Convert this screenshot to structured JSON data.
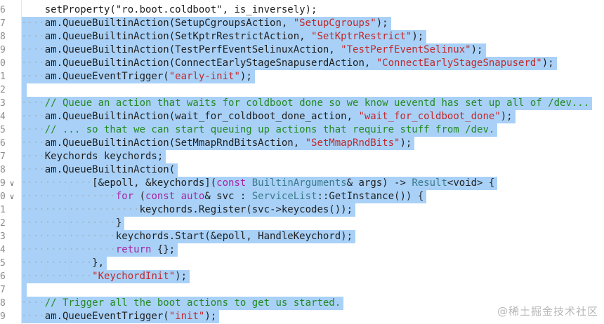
{
  "editor": {
    "line_numbers": [
      "6",
      "7",
      "8",
      "9",
      "0",
      "1",
      "2",
      "3",
      "4",
      "5",
      "6",
      "7",
      "8",
      "9",
      "0",
      "1",
      "2",
      "3",
      "4",
      "5",
      "6",
      "7",
      "8",
      "9"
    ],
    "fold_markers": {
      "13": "chevron-down",
      "14": "chevron-down"
    },
    "top_partial": "setProperty(\"ro.boot.coldboot\", is_inversely);",
    "lines": [
      {
        "indent": 1,
        "tokens": [
          [
            "am.QueueBuiltinAction(SetupCgroupsAction, ",
            "p"
          ],
          [
            "\"SetupCgroups\"",
            "s"
          ],
          [
            ");",
            "p"
          ]
        ]
      },
      {
        "indent": 1,
        "tokens": [
          [
            "am.QueueBuiltinAction(SetKptrRestrictAction, ",
            "p"
          ],
          [
            "\"SetKptrRestrict\"",
            "s"
          ],
          [
            ");",
            "p"
          ]
        ]
      },
      {
        "indent": 1,
        "tokens": [
          [
            "am.QueueBuiltinAction(TestPerfEventSelinuxAction, ",
            "p"
          ],
          [
            "\"TestPerfEventSelinux\"",
            "s"
          ],
          [
            ");",
            "p"
          ]
        ]
      },
      {
        "indent": 1,
        "tokens": [
          [
            "am.QueueBuiltinAction(ConnectEarlyStageSnapuserdAction, ",
            "p"
          ],
          [
            "\"ConnectEarlyStageSnapuserd\"",
            "s"
          ],
          [
            ");",
            "p"
          ]
        ]
      },
      {
        "indent": 1,
        "tokens": [
          [
            "am.QueueEventTrigger(",
            "p"
          ],
          [
            "\"early-init\"",
            "s"
          ],
          [
            ");",
            "p"
          ]
        ]
      },
      {
        "indent": 0,
        "tokens": []
      },
      {
        "indent": 1,
        "tokens": [
          [
            "// Queue an action that waits for coldboot done so we know ueventd has set up all of /dev...",
            "c"
          ]
        ]
      },
      {
        "indent": 1,
        "tokens": [
          [
            "am.QueueBuiltinAction(wait_for_coldboot_done_action, ",
            "p"
          ],
          [
            "\"wait_for_coldboot_done\"",
            "s"
          ],
          [
            ");",
            "p"
          ]
        ]
      },
      {
        "indent": 1,
        "tokens": [
          [
            "// ... so that we can start queuing up actions that require stuff from /dev.",
            "c"
          ]
        ]
      },
      {
        "indent": 1,
        "tokens": [
          [
            "am.QueueBuiltinAction(SetMmapRndBitsAction, ",
            "p"
          ],
          [
            "\"SetMmapRndBits\"",
            "s"
          ],
          [
            ");",
            "p"
          ]
        ]
      },
      {
        "indent": 1,
        "tokens": [
          [
            "Keychords keychords;",
            "p"
          ]
        ]
      },
      {
        "indent": 1,
        "tokens": [
          [
            "am.QueueBuiltinAction(",
            "p"
          ]
        ]
      },
      {
        "indent": 3,
        "tokens": [
          [
            "[&epoll, &keychords](",
            "p"
          ],
          [
            "const ",
            "k"
          ],
          [
            "BuiltinArguments",
            "ty"
          ],
          [
            "& args) -> ",
            "p"
          ],
          [
            "Result",
            "ty"
          ],
          [
            "<void> {",
            "p"
          ]
        ]
      },
      {
        "indent": 4,
        "tokens": [
          [
            "for ",
            "k"
          ],
          [
            "(",
            "p"
          ],
          [
            "const auto",
            "k"
          ],
          [
            "& svc : ",
            "p"
          ],
          [
            "ServiceList",
            "ty"
          ],
          [
            "::GetInstance()) {",
            "p"
          ]
        ]
      },
      {
        "indent": 5,
        "tokens": [
          [
            "keychords.Register(svc->keycodes());",
            "p"
          ]
        ]
      },
      {
        "indent": 4,
        "tokens": [
          [
            "}",
            "p"
          ]
        ]
      },
      {
        "indent": 4,
        "tokens": [
          [
            "keychords.Start(&epoll, HandleKeychord);",
            "p"
          ]
        ]
      },
      {
        "indent": 4,
        "tokens": [
          [
            "return ",
            "k"
          ],
          [
            "{};",
            "p"
          ]
        ]
      },
      {
        "indent": 3,
        "tokens": [
          [
            "},",
            "p"
          ]
        ]
      },
      {
        "indent": 3,
        "tokens": [
          [
            "\"KeychordInit\"",
            "s"
          ],
          [
            ");",
            "p"
          ]
        ]
      },
      {
        "indent": 0,
        "tokens": []
      },
      {
        "indent": 1,
        "tokens": [
          [
            "// Trigger all the boot actions to get us started.",
            "c"
          ]
        ]
      },
      {
        "indent": 1,
        "tokens": [
          [
            "am.QueueEventTrigger(",
            "p"
          ],
          [
            "\"init\"",
            "s"
          ],
          [
            ");",
            "p"
          ]
        ]
      }
    ]
  },
  "watermark": "@稀土掘金技术社区",
  "colors": {
    "selection": "#a9d1f7",
    "comment": "#248a24",
    "string": "#c0282b",
    "keyword": "#a626a4",
    "type": "#3b7a8c"
  }
}
